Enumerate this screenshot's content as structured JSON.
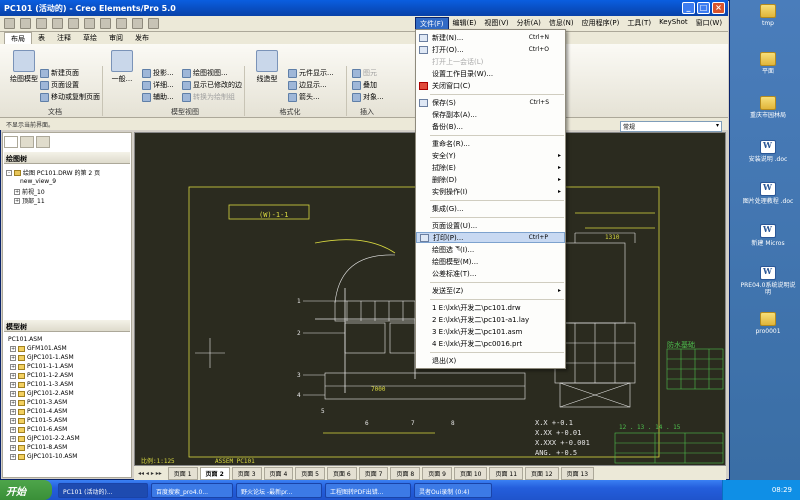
{
  "window": {
    "title": "PC101 (活动的) - Creo Elements/Pro 5.0"
  },
  "menubar": [
    "文件(F)",
    "编辑(E)",
    "视图(V)",
    "分析(A)",
    "信息(N)",
    "应用程序(P)",
    "工具(T)",
    "KeyShot",
    "窗口(W)"
  ],
  "tabs": [
    "布局",
    "表",
    "注释",
    "草绘",
    "审阅",
    "发布"
  ],
  "ribbon": {
    "doc_group": {
      "label": "文档",
      "big": "绘图模型",
      "items": [
        "新建页面",
        "页面设置",
        "移动或复制页面"
      ]
    },
    "view_group": {
      "label": "模型视图",
      "big": "一般...",
      "items": [
        "投影...",
        "详细...",
        "辅助...",
        "绘图视图...",
        "显示已修改的边",
        "转换为绘制组"
      ]
    },
    "format_group": {
      "label": "格式化",
      "big": "线造型",
      "items": [
        "元件显示...",
        "边显示...",
        "箭头..."
      ]
    },
    "insert_group": {
      "label": "插入",
      "items": [
        "图元",
        "叠加",
        "对象..."
      ]
    }
  },
  "status": {
    "message": "不显示当前界面。",
    "scale_select": "常规"
  },
  "leftpanel": {
    "drawing_tree_title": "绘图树",
    "drawing_tree": [
      "绘图 PC101.DRW 的第 2 页",
      "new_view_9",
      "前视_10",
      "顶部_11"
    ],
    "model_tree_title": "模型树",
    "model_tree": [
      "PC101.ASM",
      "GFM101.ASM",
      "GJPC101-1.ASM",
      "PC101-1-1.ASM",
      "PC101-1-2.ASM",
      "PC101-1-3.ASM",
      "GJPC101-2.ASM",
      "PC101-3.ASM",
      "PC101-4.ASM",
      "PC101-5.ASM",
      "PC101-6.ASM",
      "GJPC101-2-2.ASM",
      "PC101-8.ASM",
      "GJPC101-10.ASM"
    ]
  },
  "filemenu": {
    "items": [
      {
        "label": "新建(N)...",
        "shortcut": "Ctrl+N",
        "icon": "new-file-icon"
      },
      {
        "label": "打开(O)...",
        "shortcut": "Ctrl+O",
        "icon": "open-folder-icon"
      },
      {
        "label": "打开上一会话(L)",
        "disabled": true
      },
      {
        "label": "设置工作目录(W)..."
      },
      {
        "label": "关闭窗口(C)",
        "icon": "close-window-icon"
      },
      {
        "label": "保存(S)",
        "shortcut": "Ctrl+S",
        "icon": "save-icon"
      },
      {
        "label": "保存副本(A)..."
      },
      {
        "label": "备份(B)..."
      },
      {
        "label": "重命名(R)..."
      },
      {
        "label": "安全(Y)",
        "submenu": true
      },
      {
        "label": "拭除(E)",
        "submenu": true
      },
      {
        "label": "删除(D)",
        "submenu": true
      },
      {
        "label": "实例操作(I)",
        "submenu": true
      },
      {
        "label": "集成(G)..."
      },
      {
        "label": "页面设置(U)..."
      },
      {
        "label": "打印(P)...",
        "shortcut": "Ctrl+P",
        "icon": "printer-icon",
        "highlight": true
      },
      {
        "label": "绘图选项(I)..."
      },
      {
        "label": "绘图模型(M)..."
      },
      {
        "label": "公差标准(T)..."
      },
      {
        "label": "发送至(Z)",
        "submenu": true
      },
      {
        "label": "1 E:\\lxk\\开发二\\pc101.drw"
      },
      {
        "label": "2 E:\\lxk\\开发二\\pc101-a1.lay"
      },
      {
        "label": "3 E:\\lxk\\开发二\\pc101.asm"
      },
      {
        "label": "4 E:\\lxk\\开发二\\pc0016.prt"
      },
      {
        "label": "退出(X)"
      }
    ]
  },
  "drawing": {
    "dim_top_left": "(W)-1-1",
    "dim_right": "1310",
    "dim_center": "7000",
    "scale_label": "比例:1:125",
    "title_tag": "防水基础",
    "tolerances": [
      "X.X    +-0.1",
      "X.XX   +-0.01",
      "X.XXX  +-0.001",
      "ANG.   +-0.5"
    ],
    "bottom_strip": "ASSEM    PC101",
    "callouts": [
      "1",
      "2",
      "3",
      "4",
      "5",
      "6",
      "7",
      "8"
    ],
    "table_nums": "12 . 13 . 14 . 15"
  },
  "pages": {
    "labels": [
      "页面 1",
      "页面 2",
      "页面 3",
      "页面 4",
      "页面 5",
      "页面 6",
      "页面 7",
      "页面 8",
      "页面 9",
      "页面 10",
      "页面 11",
      "页面 12",
      "页面 13"
    ],
    "active": "页面 2"
  },
  "desktop": [
    "tmp",
    "平面",
    "重庆市园林局",
    "安装说明 .doc",
    "图片处理教程 .doc",
    "新建 Micros",
    "PRE04.0系统说明说明",
    "pro0001"
  ],
  "taskbar": {
    "start": "开始",
    "tasks": [
      "PC101 (活动的)...",
      "百度搜索_pro4.0...",
      "野火论坛 -最新pr...",
      "工程图转PDF出错...",
      "灵者Oui录制 (0:4)"
    ],
    "time": "08:29"
  }
}
